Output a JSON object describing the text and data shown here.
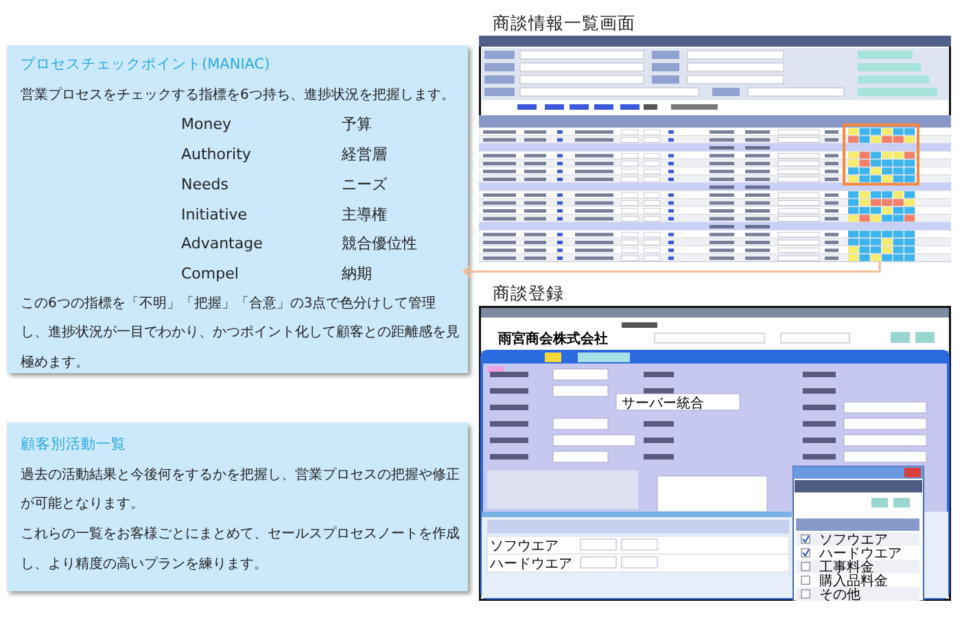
{
  "maniac_box": {
    "title": "プロセスチェックポイント(MANIAC)",
    "intro": "営業プロセスをチェックする指標を6つ持ち、進捗状況を把握します。",
    "terms": [
      {
        "en": "Money",
        "ja": "予算"
      },
      {
        "en": "Authority",
        "ja": "経営層"
      },
      {
        "en": "Needs",
        "ja": "ニーズ"
      },
      {
        "en": "Initiative",
        "ja": "主導権"
      },
      {
        "en": "Advantage",
        "ja": "競合優位性"
      },
      {
        "en": "Compel",
        "ja": "納期"
      }
    ],
    "body": "この6つの指標を「不明」「把握」「合意」の3点で色分けして管理し、進捗状況が一目でわかり、かつポイント化して顧客との距離感を見極めます。"
  },
  "activity_box": {
    "title": "顧客別活動一覧",
    "paragraphs": [
      "過去の活動結果と今後何をするかを把握し、営業プロセスの把握や修正が可能となります。",
      "これらの一覧をお客様ごとにまとめて、セールスプロセスノートを作成し、より精度の高いプランを練ります。"
    ]
  },
  "deal_list_screen": {
    "caption": "商談情報一覧画面",
    "groups": [
      {
        "rows": [
          [
            {
              "color": "#f5ec6e"
            },
            {
              "color": "#3db4ee"
            },
            {
              "color": "#3db4ee"
            },
            {
              "color": "#f5ec6e"
            },
            {
              "color": "#3db4ee"
            },
            {
              "color": "#3db4ee"
            }
          ],
          [
            {
              "color": "#f0806a"
            },
            {
              "color": "#3db4ee"
            },
            {
              "color": "#f5ec6e"
            },
            {
              "color": "#f0806a"
            },
            {
              "color": "#f0806a"
            },
            {
              "color": "#f5ec6e"
            }
          ]
        ]
      },
      {
        "rows": [
          [
            {
              "color": "#f5ec6e"
            },
            {
              "color": "#f0806a"
            },
            {
              "color": "#3db4ee"
            },
            {
              "color": "#f5ec6e"
            },
            {
              "color": "#f5ec6e"
            },
            {
              "color": "#f0806a"
            }
          ],
          [
            {
              "color": "#f5ec6e"
            },
            {
              "color": "#f0806a"
            },
            {
              "color": "#3db4ee"
            },
            {
              "color": "#3db4ee"
            },
            {
              "color": "#3db4ee"
            },
            {
              "color": "#3db4ee"
            }
          ],
          [
            {
              "color": "#3db4ee"
            },
            {
              "color": "#3db4ee"
            },
            {
              "color": "#f5ec6e"
            },
            {
              "color": "#3db4ee"
            },
            {
              "color": "#3db4ee"
            },
            {
              "color": "#3db4ee"
            }
          ],
          [
            {
              "color": "#f5ec6e"
            },
            {
              "color": "#3db4ee"
            },
            {
              "color": "#3db4ee"
            },
            {
              "color": "#f5ec6e"
            },
            {
              "color": "#3db4ee"
            },
            {
              "color": "#3db4ee"
            }
          ]
        ]
      },
      {
        "rows": [
          [
            {
              "color": "#3db4ee"
            },
            {
              "color": "#f5ec6e"
            },
            {
              "color": "#3db4ee"
            },
            {
              "color": "#3db4ee"
            },
            {
              "color": "#f5ec6e"
            },
            {
              "color": "#3db4ee"
            }
          ],
          [
            {
              "color": "#3db4ee"
            },
            {
              "color": "#f5ec6e"
            },
            {
              "color": "#f0806a"
            },
            {
              "color": "#f0806a"
            },
            {
              "color": "#f0806a"
            },
            {
              "color": "#f5ec6e"
            }
          ],
          [
            {
              "color": "#3db4ee"
            },
            {
              "color": "#3db4ee"
            },
            {
              "color": "#3db4ee"
            },
            {
              "color": "#f5ec6e"
            },
            {
              "color": "#3db4ee"
            },
            {
              "color": "#3db4ee"
            }
          ],
          [
            {
              "color": "#f5ec6e"
            },
            {
              "color": "#f0806a"
            },
            {
              "color": "#f5ec6e"
            },
            {
              "color": "#3db4ee"
            },
            {
              "color": "#3db4ee"
            },
            {
              "color": "#f0806a"
            }
          ]
        ]
      },
      {
        "rows": [
          [
            {
              "color": "#3db4ee"
            },
            {
              "color": "#3db4ee"
            },
            {
              "color": "#3db4ee"
            },
            {
              "color": "#3db4ee"
            },
            {
              "color": "#3db4ee"
            },
            {
              "color": "#3db4ee"
            }
          ],
          [
            {
              "color": "#3db4ee"
            },
            {
              "color": "#3db4ee"
            },
            {
              "color": "#3db4ee"
            },
            {
              "color": "#f5ec6e"
            },
            {
              "color": "#3db4ee"
            },
            {
              "color": "#3db4ee"
            }
          ],
          [
            {
              "color": "#f5ec6e"
            },
            {
              "color": "#3db4ee"
            },
            {
              "color": "#3db4ee"
            },
            {
              "color": "#f5ec6e"
            },
            {
              "color": "#3db4ee"
            },
            {
              "color": "#3db4ee"
            }
          ],
          [
            {
              "color": "#f5ec6e"
            },
            {
              "color": "#3db4ee"
            },
            {
              "color": "#f5ec6e"
            },
            {
              "color": "#3db4ee"
            },
            {
              "color": "#3db4ee"
            },
            {
              "color": "#3db4ee"
            }
          ]
        ]
      }
    ]
  },
  "deal_entry_screen": {
    "caption": "商談登録",
    "company": "雨宮商会株式会社",
    "subject": "サーバー統合",
    "products": [
      "ソフウエア",
      "ハードウエア"
    ],
    "picker_items": [
      {
        "label": "ソフウエア",
        "checked": true
      },
      {
        "label": "ハードウエア",
        "checked": true
      },
      {
        "label": "工事料金",
        "checked": false
      },
      {
        "label": "購入品料金",
        "checked": false
      },
      {
        "label": "その他",
        "checked": false
      }
    ]
  }
}
